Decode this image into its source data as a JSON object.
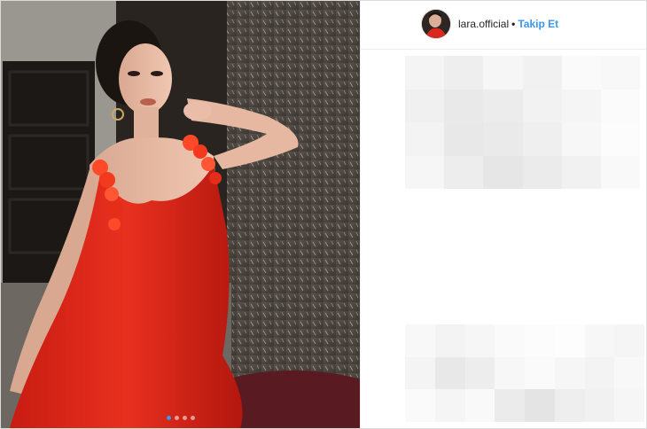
{
  "post": {
    "username": "lara.official",
    "separator": "•",
    "follow_label": "Takip Et",
    "carousel": {
      "total": 4,
      "active_index": 0
    }
  },
  "colors": {
    "follow_blue": "#3897f0",
    "dress_red": "#e0281c",
    "wall_dark": "#4a4540",
    "active_dot": "#3897f0"
  },
  "icons": {
    "carousel_dot": "carousel-dot-icon"
  },
  "pixelated_regions": {
    "upper_comments": [
      "#f4f4f4",
      "#eeeeee",
      "#f6f6f6",
      "#f1f1f1",
      "#fafafa",
      "#f8f8f8",
      "#f0f0f0",
      "#e9e9e9",
      "#ececec",
      "#f2f2f2",
      "#f5f5f5",
      "#fbfbfb",
      "#f3f3f3",
      "#e8e8e8",
      "#eaeaea",
      "#efefef",
      "#f7f7f7",
      "#fcfcfc",
      "#f6f6f6",
      "#ededed",
      "#e6e6e6",
      "#ebebeb",
      "#f1f1f1",
      "#f9f9f9"
    ],
    "lower_comments": [
      "#f8f8f8",
      "#f3f3f3",
      "#f6f6f6",
      "#fafafa",
      "#fcfcfc",
      "#fdfdfd",
      "#f7f7f7",
      "#f5f5f5",
      "#f4f4f4",
      "#e8e8e8",
      "#ededed",
      "#f7f7f7",
      "#fafafa",
      "#f6f6f6",
      "#f3f3f3",
      "#f8f8f8",
      "#fafafa",
      "#f5f5f5",
      "#f9f9f9",
      "#ebebeb",
      "#e4e4e4",
      "#eeeeee",
      "#f1f1f1",
      "#f6f6f6"
    ]
  }
}
